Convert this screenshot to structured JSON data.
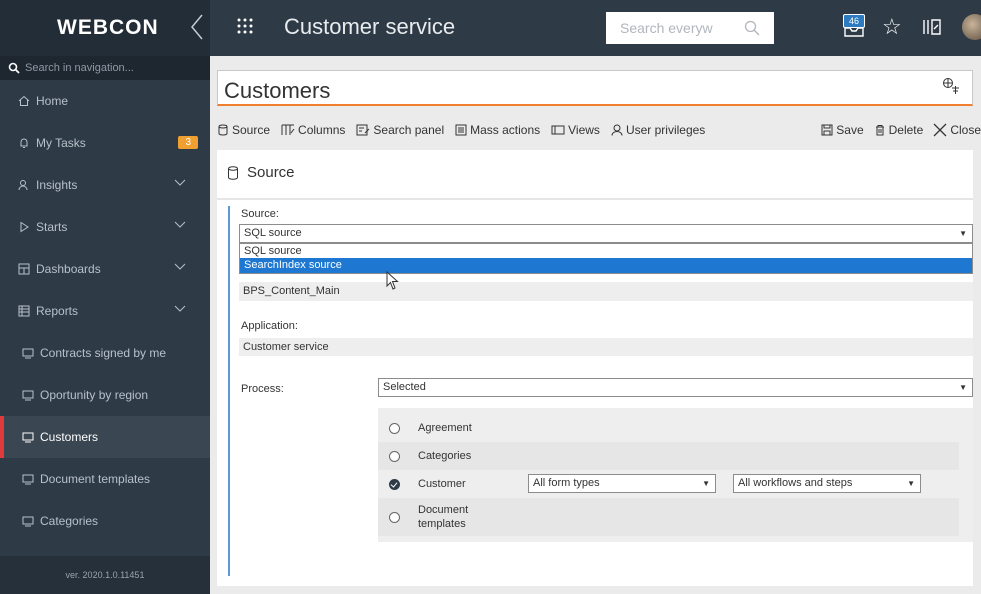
{
  "sidebar": {
    "logo": "WEBCON",
    "search_placeholder": "Search in navigation...",
    "items": [
      {
        "label": "Home"
      },
      {
        "label": "My Tasks",
        "badge": "3"
      },
      {
        "label": "Insights"
      },
      {
        "label": "Starts"
      },
      {
        "label": "Dashboards"
      },
      {
        "label": "Reports"
      },
      {
        "label": "Contracts signed by me"
      },
      {
        "label": "Oportunity by region"
      },
      {
        "label": "Customers"
      },
      {
        "label": "Document templates"
      },
      {
        "label": "Categories"
      }
    ],
    "version": "ver. 2020.1.0.11451"
  },
  "topbar": {
    "app_title": "Customer service",
    "search_placeholder": "Search everyw",
    "notification_count": "46"
  },
  "page": {
    "title": "Customers"
  },
  "toolbar": {
    "source": "Source",
    "columns": "Columns",
    "search_panel": "Search panel",
    "mass_actions": "Mass actions",
    "views": "Views",
    "user_privileges": "User privileges",
    "save": "Save",
    "delete": "Delete",
    "close": "Close"
  },
  "panel": {
    "heading": "Source",
    "source_label": "Source:",
    "source_value": "SQL source",
    "source_options": [
      "SQL source",
      "SearchIndex source"
    ],
    "content_value": "BPS_Content_Main",
    "application_label": "Application:",
    "application_value": "Customer service",
    "process_label": "Process:",
    "process_value": "Selected",
    "processes": [
      {
        "label": "Agreement",
        "checked": false
      },
      {
        "label": "Categories",
        "checked": false
      },
      {
        "label": "Customer",
        "checked": true,
        "form_types": "All form types",
        "workflows": "All workflows and steps"
      },
      {
        "label": "Document templates",
        "checked": false
      }
    ]
  }
}
